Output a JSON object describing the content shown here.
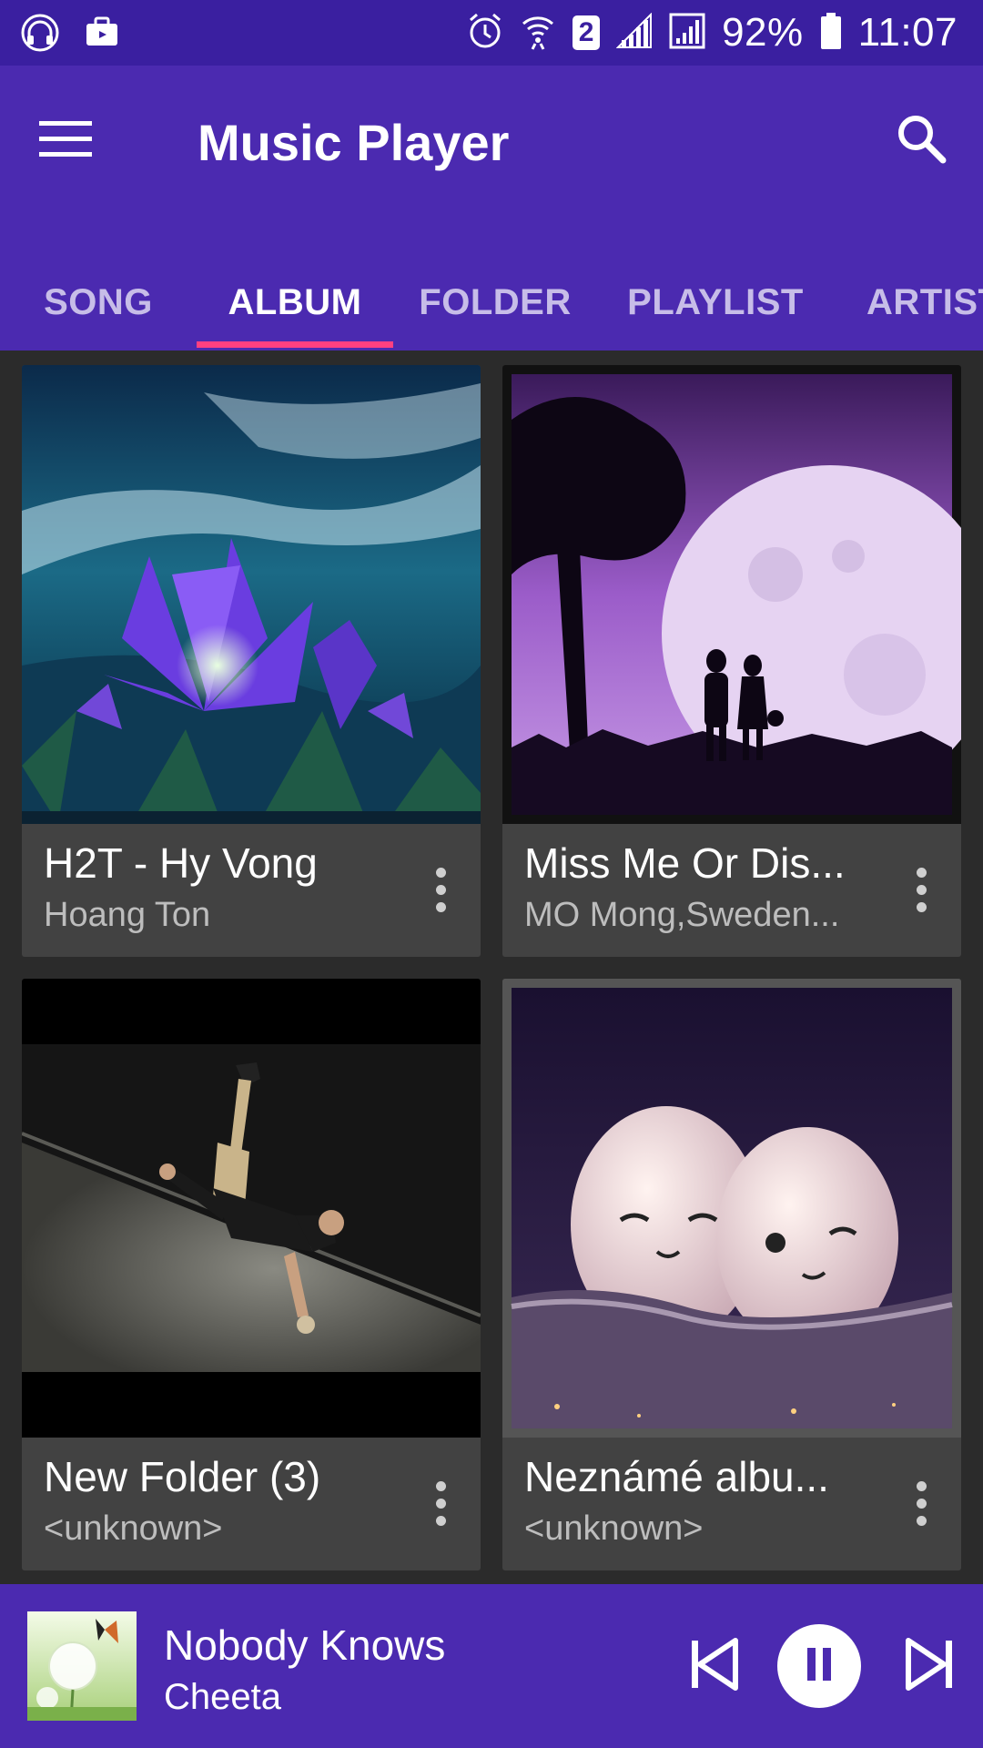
{
  "status_bar": {
    "battery": "92%",
    "time": "11:07",
    "sim_badge": "2",
    "icons": [
      "headphones-music-icon",
      "cast-icon",
      "alarm-icon",
      "wifi-icon",
      "signal-icon",
      "signal-icon",
      "battery-icon"
    ]
  },
  "app_bar": {
    "title": "Music Player",
    "menu_icon": "hamburger-menu-icon",
    "search_icon": "search-icon"
  },
  "tabs": [
    {
      "label": "SONG",
      "active": false
    },
    {
      "label": "ALBUM",
      "active": true
    },
    {
      "label": "FOLDER",
      "active": false
    },
    {
      "label": "PLAYLIST",
      "active": false
    },
    {
      "label": "ARTIST",
      "active": false
    }
  ],
  "albums": [
    {
      "title": "H2T - Hy Vong",
      "artist": "Hoang Ton",
      "art": "fantasy-flower-artwork"
    },
    {
      "title": "Miss Me Or Dis...",
      "artist": "MO Mong,Sweden...",
      "art": "moon-couple-silhouette-artwork"
    },
    {
      "title": "New Folder (3)",
      "artist": "<unknown>",
      "art": "breakdancer-photo"
    },
    {
      "title": "Neznámé albu...",
      "artist": "<unknown>",
      "art": "eggs-smiling-artwork"
    }
  ],
  "now_playing": {
    "title": "Nobody Knows",
    "artist": "Cheeta",
    "art": "dandelion-butterfly-artwork"
  },
  "colors": {
    "status_bar": "#3a1fa0",
    "primary": "#4b2ab0",
    "accent": "#ff4081",
    "card": "#424242",
    "background": "#2b2b2b"
  }
}
